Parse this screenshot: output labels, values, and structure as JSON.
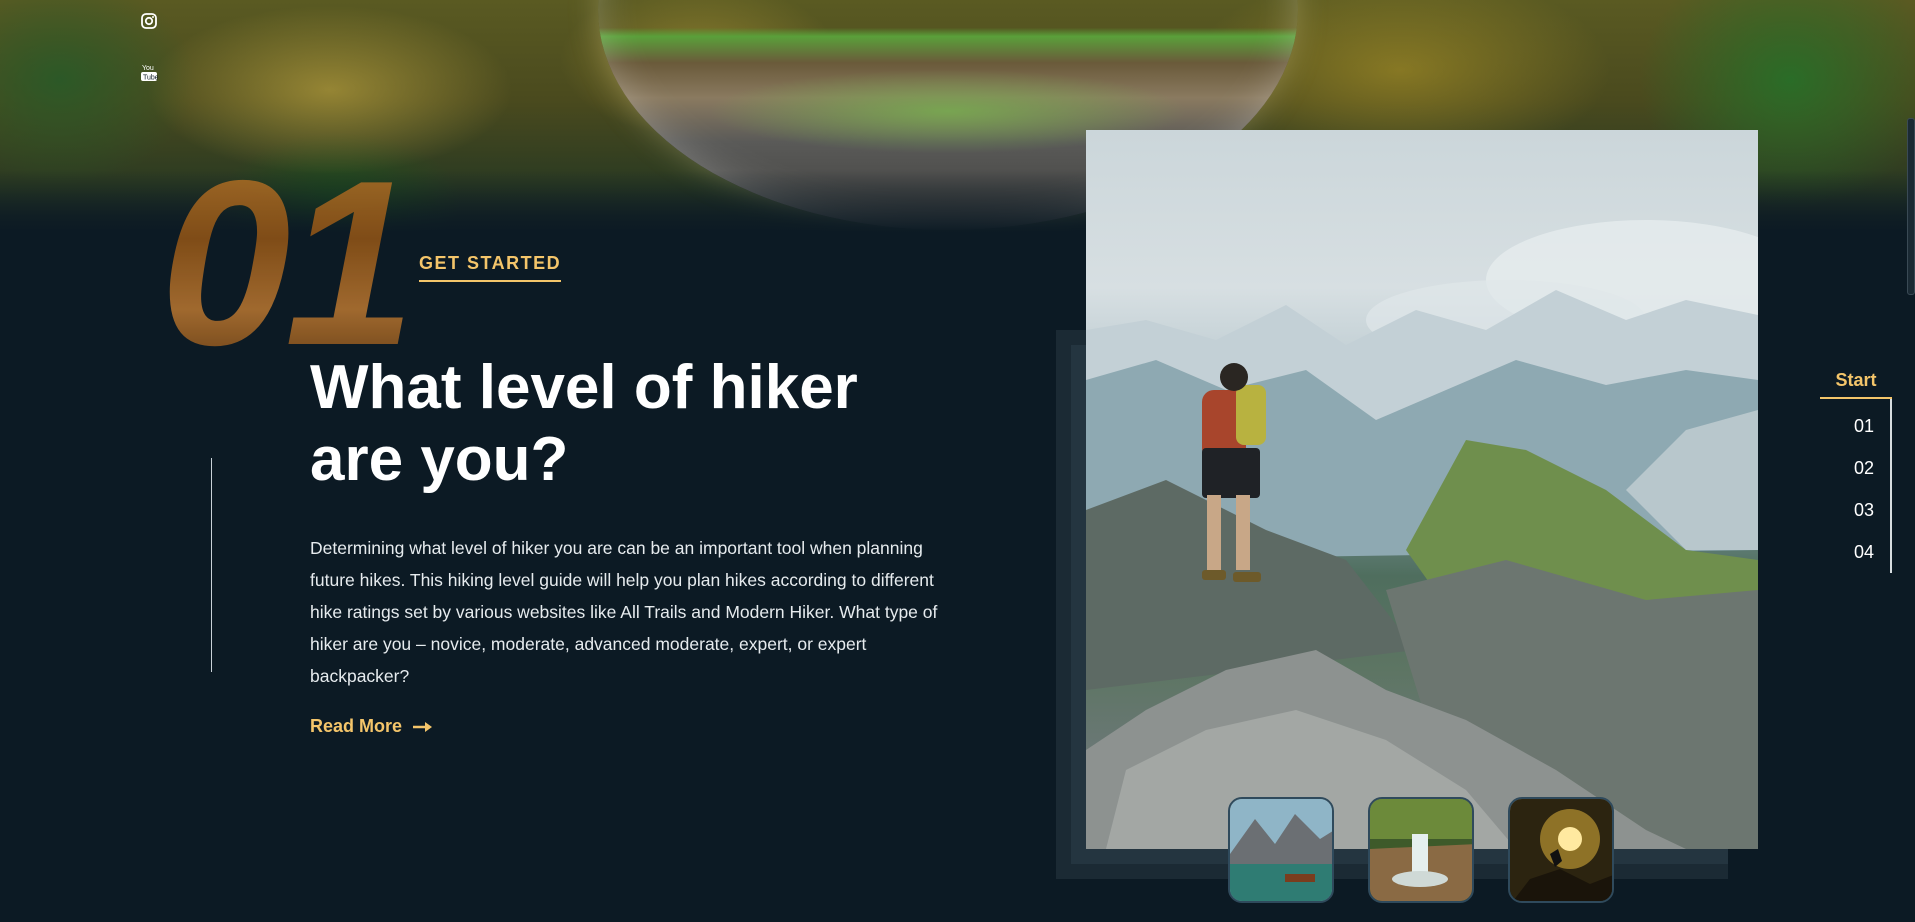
{
  "social": {
    "icons": [
      "instagram-icon",
      "youtube-icon"
    ]
  },
  "section": {
    "number": "01",
    "kicker": "GET STARTED",
    "headline": "What level of hiker are you?",
    "body": "Determining what level of hiker you are can be an important tool when planning future hikes. This hiking level guide will help you plan hikes according to different hike ratings set by various websites like All Trails and Modern Hiker. What type of hiker are you – novice, moderate, advanced moderate, expert, or expert backpacker?",
    "read_more": "Read More",
    "read_more_icon": "arrow-right-icon"
  },
  "side_nav": {
    "start": "Start",
    "items": [
      "01",
      "02",
      "03",
      "04"
    ]
  },
  "thumbnails": [
    "lake-mountain-thumbnail",
    "waterfall-thumbnail",
    "sunset-climber-thumbnail"
  ],
  "colors": {
    "accent": "#f4c56a",
    "background": "#0c1a24",
    "number_gradient": "#a5672a"
  }
}
